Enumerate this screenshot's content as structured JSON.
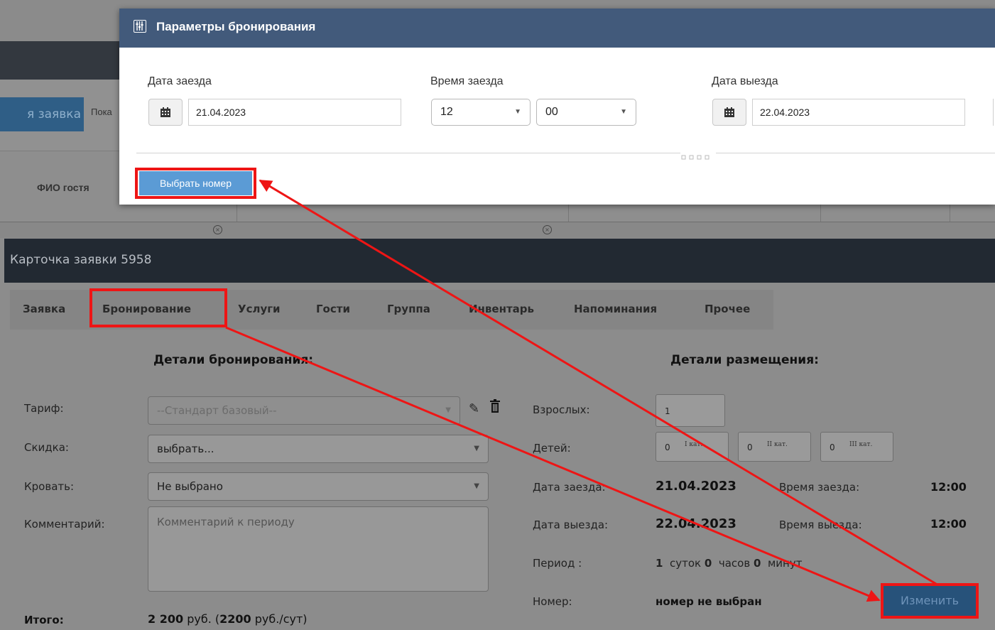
{
  "background": {
    "new_request_btn": "я заявка",
    "show_label": "Пока",
    "guest_name_header": "ФИО гостя"
  },
  "card": {
    "title": "Карточка заявки 5958",
    "tabs": [
      {
        "label": "Заявка"
      },
      {
        "label": "Бронирование"
      },
      {
        "label": "Услуги"
      },
      {
        "label": "Гости"
      },
      {
        "label": "Группа"
      },
      {
        "label": "Инвентарь"
      },
      {
        "label": "Напоминания"
      },
      {
        "label": "Прочее"
      }
    ],
    "booking_details": {
      "title": "Детали бронирования:",
      "tariff_label": "Тариф:",
      "tariff_value": "--Стандарт базовый--",
      "discount_label": "Скидка:",
      "discount_value": "выбрать...",
      "bed_label": "Кровать:",
      "bed_value": "Не выбрано",
      "comment_label": "Комментарий:",
      "comment_placeholder": "Комментарий к периоду",
      "total_label": "Итого:",
      "total_amount": "2 200",
      "total_currency": " руб. (",
      "total_rate": "2200",
      "total_rate_unit": " руб./сут)"
    },
    "placement_details": {
      "title": "Детали размещения:",
      "adults_label": "Взрослых:",
      "adults_value": "1",
      "children_label": "Детей:",
      "children": [
        {
          "value": "0",
          "cat": "I кат."
        },
        {
          "value": "0",
          "cat": "II кат."
        },
        {
          "value": "0",
          "cat": "III кат."
        }
      ],
      "checkin_date_label": "Дата заезда:",
      "checkin_date": "21.04.2023",
      "checkin_time_label": "Время заезда:",
      "checkin_time": "12:00",
      "checkout_date_label": "Дата выезда:",
      "checkout_date": "22.04.2023",
      "checkout_time_label": "Время выезда:",
      "checkout_time": "12:00",
      "period_label": "Период :",
      "period_days": "1",
      "period_days_unit": "суток",
      "period_hours": "0",
      "period_hours_unit": "часов",
      "period_minutes": "0",
      "period_minutes_unit": "минут",
      "room_label": "Номер:",
      "room_value": "номер не выбран",
      "change_button": "Изменить"
    }
  },
  "modal": {
    "title": "Параметры бронирования",
    "checkin_date_label": "Дата заезда",
    "checkin_date": "21.04.2023",
    "checkin_time_label": "Время заезда",
    "checkin_hour": "12",
    "checkin_minute": "00",
    "checkout_date_label": "Дата выезда",
    "checkout_date": "22.04.2023",
    "choose_room_button": "Выбрать номер"
  },
  "colors": {
    "highlight": "#ee1515",
    "modal_header": "#425a7b",
    "primary_button": "#5b9bd5"
  }
}
